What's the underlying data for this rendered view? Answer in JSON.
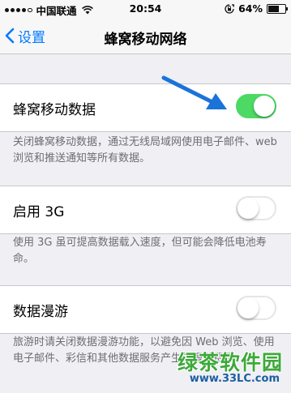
{
  "status_bar": {
    "carrier": "中国联通",
    "time": "20:54",
    "battery_percent": "64%",
    "battery_level": 0.64,
    "signal_bars_filled": 4,
    "signal_bars_total": 5
  },
  "nav": {
    "back_label": "设置",
    "title": "蜂窝移动网络"
  },
  "settings": [
    {
      "label": "蜂窝移动数据",
      "on": true,
      "footer": "关闭蜂窝移动数据，通过无线局域网使用电子邮件、web 浏览和推送通知等所有数据。"
    },
    {
      "label": "启用 3G",
      "on": false,
      "footer": "使用 3G 虽可提高数据载入速度，但可能会降低电池寿命。"
    },
    {
      "label": "数据漫游",
      "on": false,
      "footer": "旅游时请关闭数据漫游功能，以避免因 Web 浏览、使用电子邮件、彩信和其他数据服务产生的漫游费用。"
    }
  ],
  "watermark": {
    "title": "绿茶软件园",
    "url": "www.33LC.com"
  },
  "colors": {
    "accent": "#007aff",
    "toggle_on": "#4cd964",
    "arrow": "#1a73d9",
    "background": "#efeff4"
  }
}
